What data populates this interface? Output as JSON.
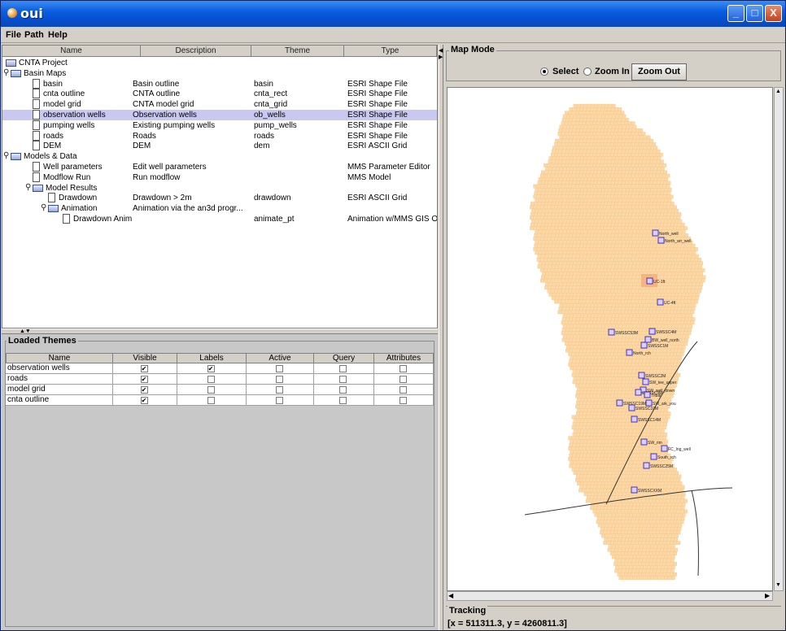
{
  "window": {
    "title": "oui"
  },
  "titlebar_buttons": {
    "minimize": "_",
    "maximize": "□",
    "close": "X"
  },
  "menu": [
    "File",
    "Path",
    "Help"
  ],
  "tree": {
    "columns": [
      "Name",
      "Description",
      "Theme",
      "Type"
    ],
    "rows": [
      {
        "name": "CNTA Project",
        "description": "",
        "theme": "",
        "type": "",
        "level": 0,
        "icon": "folder-icon",
        "selected": false
      },
      {
        "name": "Basin Maps",
        "description": "",
        "theme": "",
        "type": "",
        "level": 1,
        "icon": "folder-icon",
        "selected": false
      },
      {
        "name": "basin",
        "description": "Basin outline",
        "theme": "basin",
        "type": "ESRI Shape File",
        "level": 2,
        "icon": "doc-icon",
        "selected": false
      },
      {
        "name": "cnta outline",
        "description": "CNTA outline",
        "theme": "cnta_rect",
        "type": "ESRI Shape File",
        "level": 2,
        "icon": "doc-icon",
        "selected": false
      },
      {
        "name": "model grid",
        "description": "CNTA model grid",
        "theme": "cnta_grid",
        "type": "ESRI Shape File",
        "level": 2,
        "icon": "doc-icon",
        "selected": false
      },
      {
        "name": "observation wells",
        "description": "Observation wells",
        "theme": "ob_wells",
        "type": "ESRI Shape File",
        "level": 2,
        "icon": "doc-icon",
        "selected": true
      },
      {
        "name": "pumping wells",
        "description": "Existing pumping wells",
        "theme": "pump_wells",
        "type": "ESRI Shape File",
        "level": 2,
        "icon": "doc-icon",
        "selected": false
      },
      {
        "name": "roads",
        "description": "Roads",
        "theme": "roads",
        "type": "ESRI Shape File",
        "level": 2,
        "icon": "doc-icon",
        "selected": false
      },
      {
        "name": "DEM",
        "description": "DEM",
        "theme": "dem",
        "type": "ESRI ASCII Grid",
        "level": 2,
        "icon": "doc-icon",
        "selected": false
      },
      {
        "name": "Models & Data",
        "description": "",
        "theme": "",
        "type": "",
        "level": 1,
        "icon": "folder-icon",
        "selected": false
      },
      {
        "name": "Well parameters",
        "description": "Edit well parameters",
        "theme": "",
        "type": "MMS Parameter Editor",
        "level": 2,
        "icon": "doc-icon",
        "selected": false
      },
      {
        "name": "Modflow Run",
        "description": "Run modflow",
        "theme": "",
        "type": "MMS Model",
        "level": 2,
        "icon": "doc-icon",
        "selected": false
      },
      {
        "name": "Model Results",
        "description": "",
        "theme": "",
        "type": "",
        "level": 2,
        "icon": "folder-icon",
        "selected": false
      },
      {
        "name": "Drawdown",
        "description": "Drawdown > 2m",
        "theme": "drawdown",
        "type": "ESRI ASCII Grid",
        "level": 3,
        "icon": "doc-icon",
        "selected": false
      },
      {
        "name": "Animation",
        "description": "Animation via the an3d progr...",
        "theme": "",
        "type": "",
        "level": 3,
        "icon": "folder-icon",
        "selected": false
      },
      {
        "name": "Drawdown Anim",
        "description": "",
        "theme": "animate_pt",
        "type": "Animation w/MMS GIS O...",
        "level": 4,
        "icon": "doc-icon",
        "selected": false
      }
    ]
  },
  "loaded_themes": {
    "title": "Loaded Themes",
    "columns": [
      "Name",
      "Visible",
      "Labels",
      "Active",
      "Query",
      "Attributes"
    ],
    "rows": [
      {
        "name": "observation wells",
        "visible": true,
        "labels": true,
        "active": false,
        "query": false,
        "attributes": false
      },
      {
        "name": "roads",
        "visible": true,
        "labels": false,
        "active": false,
        "query": false,
        "attributes": false
      },
      {
        "name": "model grid",
        "visible": true,
        "labels": false,
        "active": false,
        "query": false,
        "attributes": false
      },
      {
        "name": "cnta outline",
        "visible": true,
        "labels": false,
        "active": false,
        "query": false,
        "attributes": false
      }
    ]
  },
  "map_mode": {
    "title": "Map Mode",
    "select_label": "Select",
    "zoom_in_label": "Zoom In",
    "zoom_out_label": "Zoom Out",
    "selected": "Select"
  },
  "map": {
    "grid_fill": "#fcd8a4",
    "grid_line": "#f0c08a",
    "well_border": "#4a2fb0",
    "wells": [
      "North_well",
      "North_arr_well",
      "UC-1ft",
      "UC-4ft",
      "SWSSC53M",
      "SWSSC4M",
      "BW_well_north",
      "SWSSC1M",
      "North_rch",
      "SWSSC2M",
      "SW_tee_upper",
      "SW_well_down",
      "SWSSC9M",
      "Tribal",
      "SW_ark_you",
      "SWSSC19M",
      "SWSSC10M",
      "SWSSC14M",
      "SW_rim",
      "FC_Ing_well",
      "South_rch",
      "SWSSC25M",
      "SWSSCXXM"
    ]
  },
  "tracking": {
    "title": "Tracking",
    "value": "[x = 511311.3,   y = 4260811.3]"
  }
}
